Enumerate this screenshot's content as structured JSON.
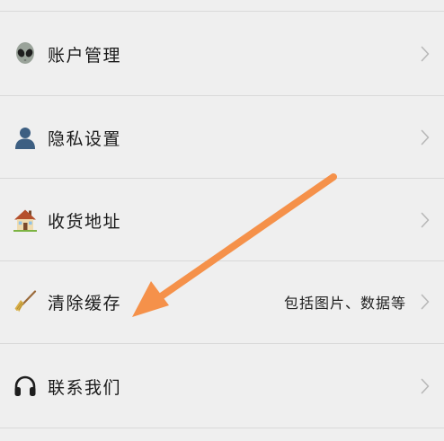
{
  "settings": {
    "items": [
      {
        "label": "账户管理",
        "icon": "alien-icon",
        "detail": ""
      },
      {
        "label": "隐私设置",
        "icon": "user-silhouette-icon",
        "detail": ""
      },
      {
        "label": "收货地址",
        "icon": "house-icon",
        "detail": ""
      },
      {
        "label": "清除缓存",
        "icon": "broom-icon",
        "detail": "包括图片、数据等"
      },
      {
        "label": "联系我们",
        "icon": "headphones-icon",
        "detail": ""
      }
    ]
  },
  "annotation": {
    "arrow_color": "#f5914a"
  },
  "colors": {
    "background": "#efefef",
    "divider": "#d9d9d9",
    "chevron": "#b8b8b8",
    "text": "#1a1a1a"
  }
}
